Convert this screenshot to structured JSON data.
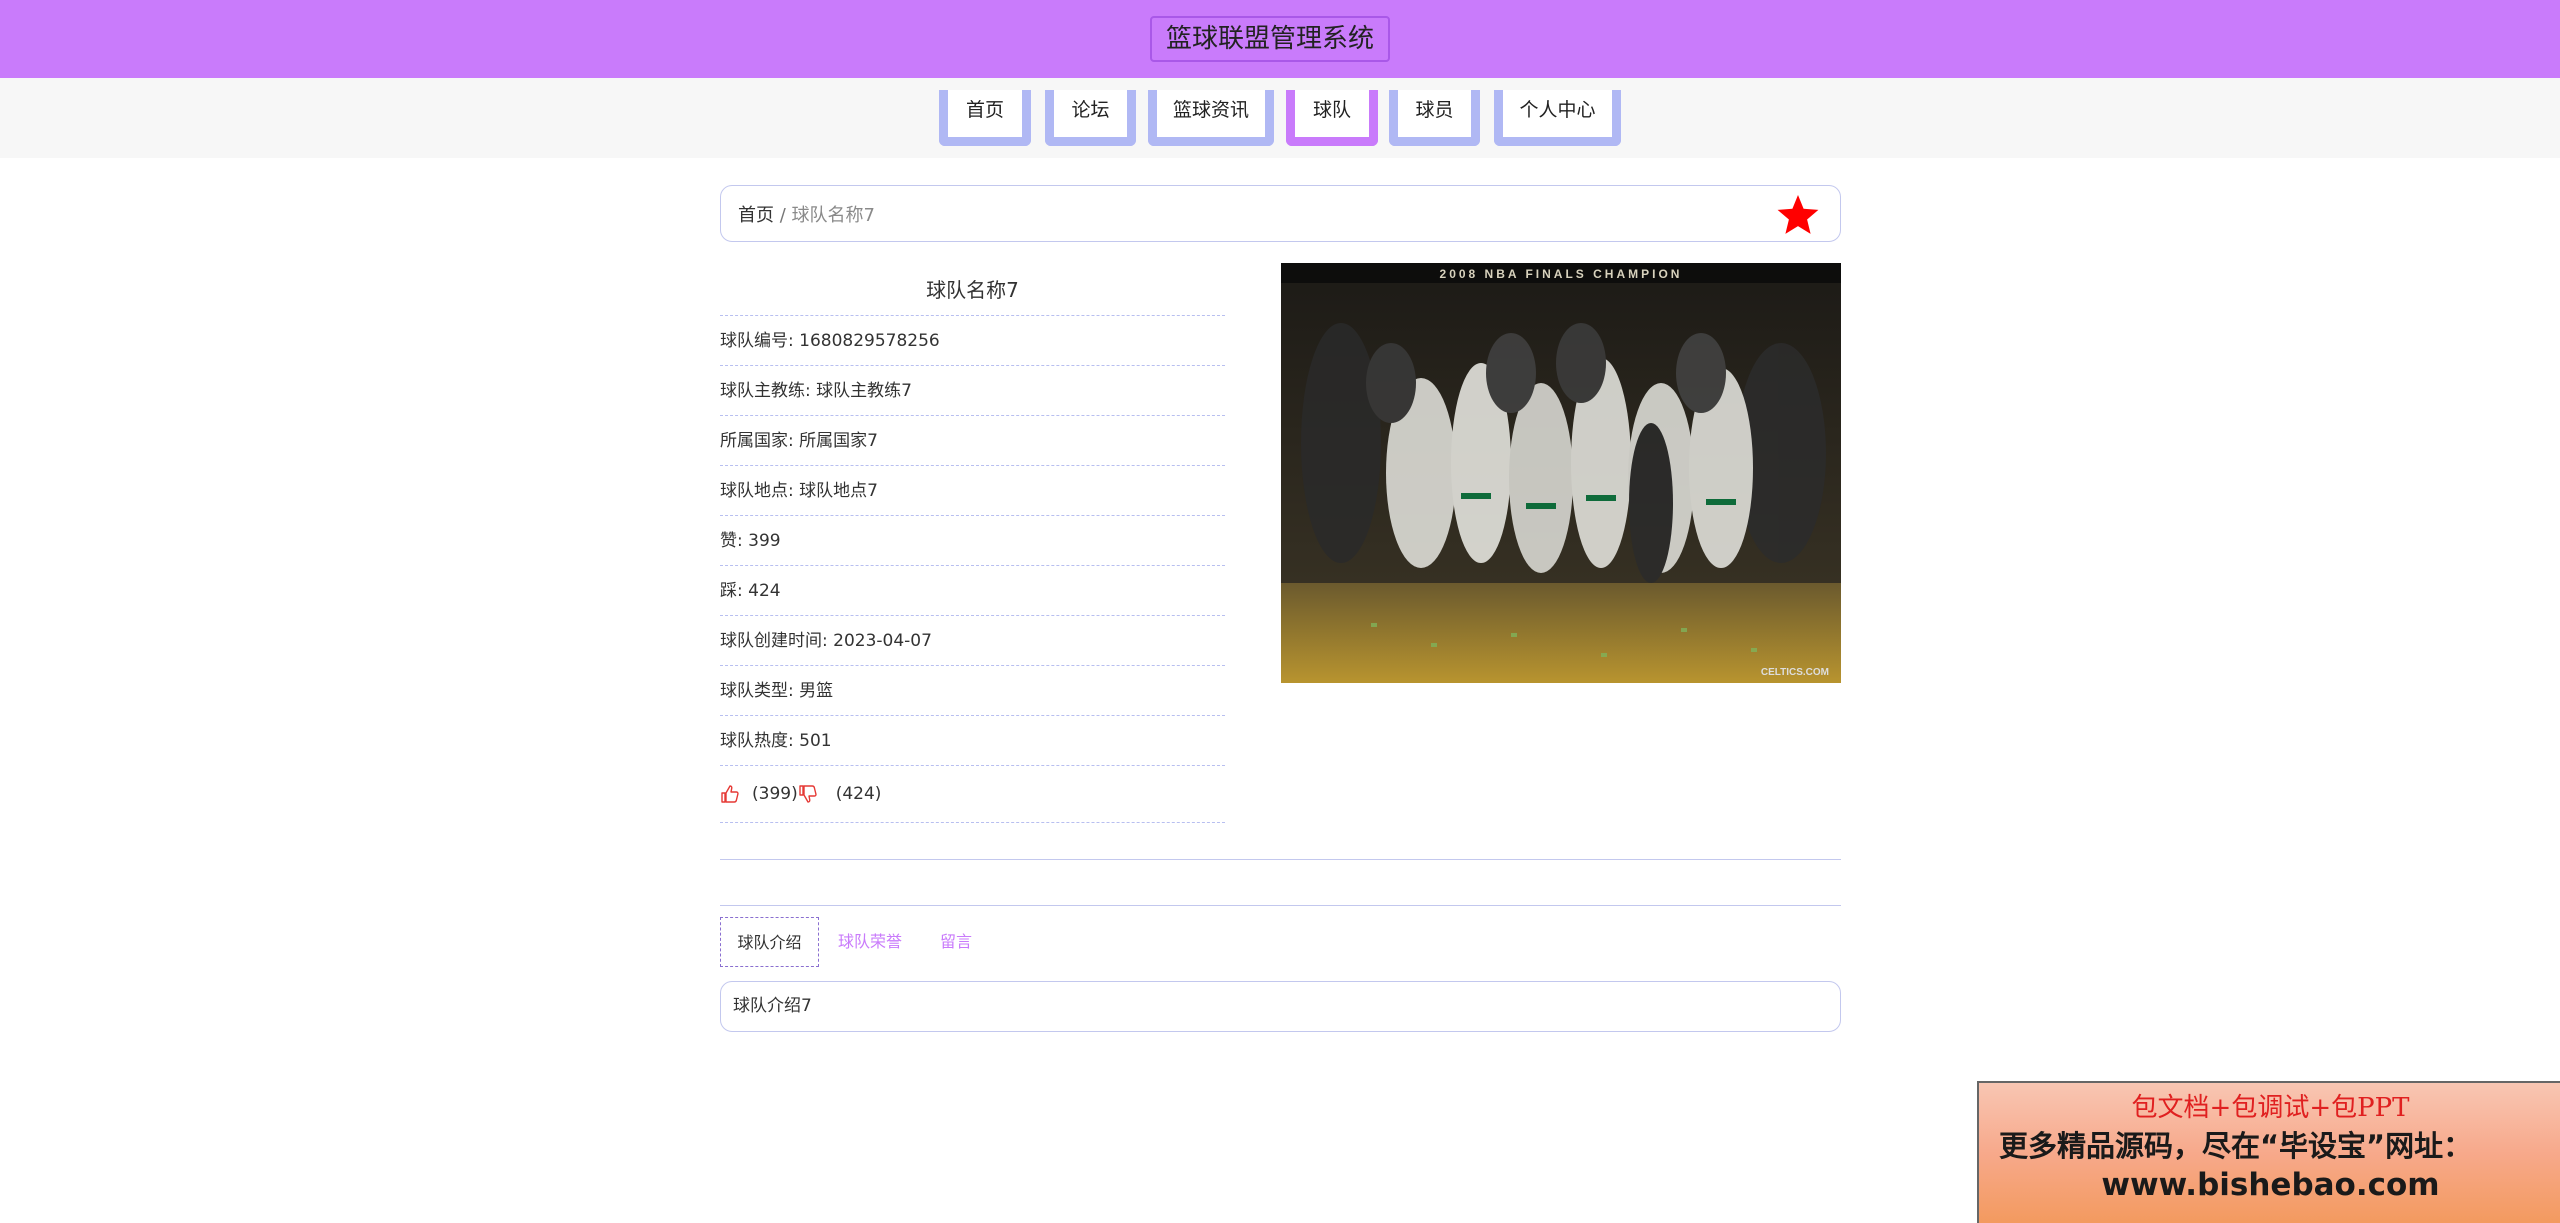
{
  "site": {
    "title": "篮球联盟管理系统"
  },
  "nav": {
    "items": [
      {
        "label": "首页"
      },
      {
        "label": "论坛"
      },
      {
        "label": "篮球资讯"
      },
      {
        "label": "球队"
      },
      {
        "label": "球员"
      },
      {
        "label": "个人中心"
      }
    ],
    "active_index": 3
  },
  "breadcrumb": {
    "home": "首页",
    "separator": "/",
    "current": "球队名称7"
  },
  "favorite": {
    "icon": "star-icon",
    "color": "#ff0000"
  },
  "team": {
    "name": "球队名称7",
    "rows": [
      {
        "label": "球队编号",
        "value": "1680829578256"
      },
      {
        "label": "球队主教练",
        "value": "球队主教练7"
      },
      {
        "label": "所属国家",
        "value": "所属国家7"
      },
      {
        "label": "球队地点",
        "value": "球队地点7"
      },
      {
        "label": "赞",
        "value": "399"
      },
      {
        "label": "踩",
        "value": "424"
      },
      {
        "label": "球队创建时间",
        "value": "2023-04-07"
      },
      {
        "label": "球队类型",
        "value": "男篮"
      },
      {
        "label": "球队热度",
        "value": "501"
      }
    ],
    "votes": {
      "up_icon": "thumbs-up-icon",
      "up_count": "(399)",
      "down_icon": "thumbs-down-icon",
      "down_count": "(424)"
    }
  },
  "photo": {
    "banner_text": "2008 NBA FINALS CHAMPION",
    "watermark": "CELTICS.COM"
  },
  "tabs": {
    "items": [
      {
        "label": "球队介绍"
      },
      {
        "label": "球队荣誉"
      },
      {
        "label": "留言"
      }
    ],
    "active_index": 0,
    "content": "球队介绍7"
  },
  "ad": {
    "line1": "包文档+包调试+包PPT",
    "line2": "更多精品源码，尽在“毕设宝”网址：",
    "line3": "www.bishebao.com"
  },
  "colors": {
    "header": "#c97bfb",
    "nav_border": "#b0b8f4",
    "accent": "#c97bfb",
    "divider": "#c3c8ee",
    "vote_icon": "#e53935"
  }
}
